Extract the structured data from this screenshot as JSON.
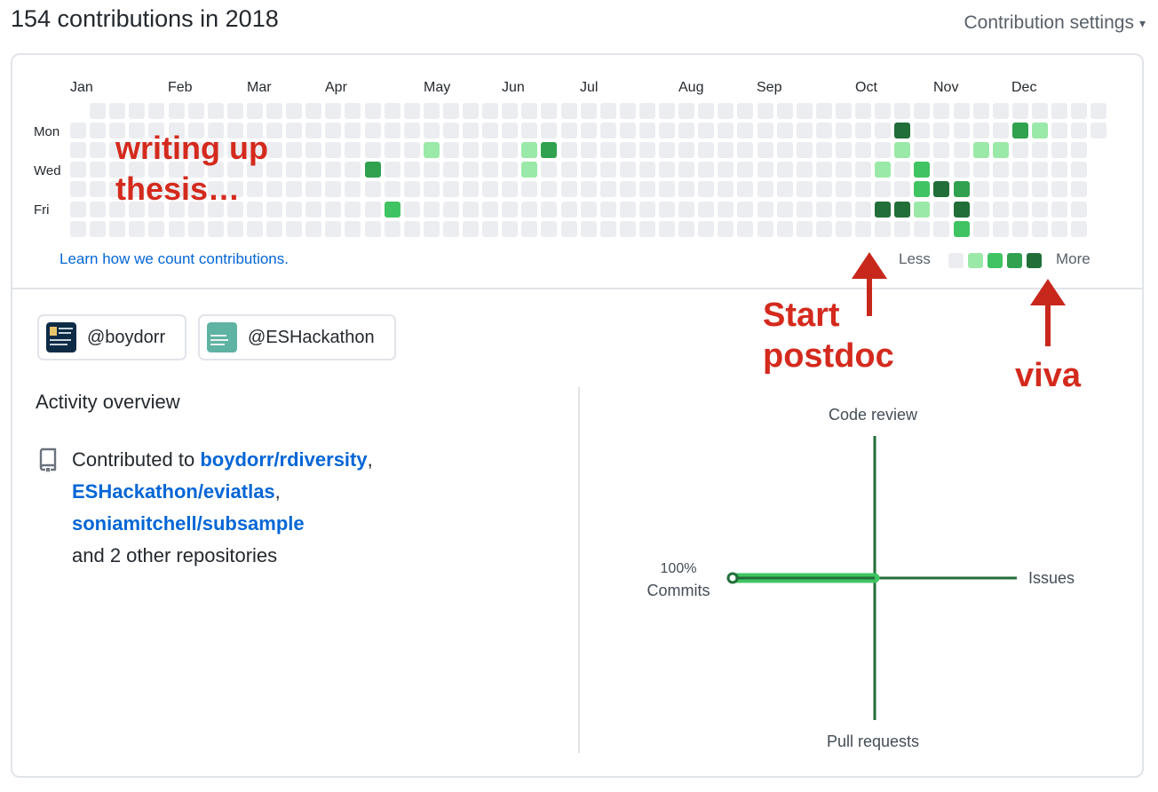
{
  "header": {
    "title": "154 contributions in 2018",
    "settings_label": "Contribution settings"
  },
  "calendar": {
    "months": [
      "Jan",
      "Feb",
      "Mar",
      "Apr",
      "May",
      "Jun",
      "Jul",
      "Aug",
      "Sep",
      "Oct",
      "Nov",
      "Dec"
    ],
    "days": [
      "Mon",
      "Wed",
      "Fri"
    ],
    "levels": [
      "#ebedf0",
      "#9be9a8",
      "#40c463",
      "#30a14e",
      "#216e39"
    ],
    "active_cells": [
      {
        "week": 15,
        "day": 3,
        "level": 3
      },
      {
        "week": 16,
        "day": 5,
        "level": 2
      },
      {
        "week": 18,
        "day": 2,
        "level": 1
      },
      {
        "week": 23,
        "day": 2,
        "level": 1
      },
      {
        "week": 23,
        "day": 3,
        "level": 1
      },
      {
        "week": 24,
        "day": 2,
        "level": 3
      },
      {
        "week": 41,
        "day": 3,
        "level": 1
      },
      {
        "week": 41,
        "day": 5,
        "level": 4
      },
      {
        "week": 42,
        "day": 1,
        "level": 4
      },
      {
        "week": 42,
        "day": 2,
        "level": 1
      },
      {
        "week": 42,
        "day": 5,
        "level": 4
      },
      {
        "week": 43,
        "day": 3,
        "level": 2
      },
      {
        "week": 43,
        "day": 4,
        "level": 2
      },
      {
        "week": 43,
        "day": 5,
        "level": 1
      },
      {
        "week": 44,
        "day": 4,
        "level": 4
      },
      {
        "week": 45,
        "day": 4,
        "level": 3
      },
      {
        "week": 45,
        "day": 5,
        "level": 4
      },
      {
        "week": 45,
        "day": 6,
        "level": 2
      },
      {
        "week": 46,
        "day": 2,
        "level": 1
      },
      {
        "week": 47,
        "day": 2,
        "level": 1
      },
      {
        "week": 48,
        "day": 1,
        "level": 3
      },
      {
        "week": 49,
        "day": 1,
        "level": 1
      }
    ],
    "learn_link": "Learn how we count contributions.",
    "legend_less": "Less",
    "legend_more": "More"
  },
  "annotations": {
    "thesis": "writing up thesis…",
    "postdoc": "Start postdoc",
    "viva": "viva"
  },
  "orgs": [
    {
      "handle": "@boydorr",
      "icon": "university-of-glasgow-logo"
    },
    {
      "handle": "@ESHackathon",
      "icon": "evidence-synthesis-hackathon-logo"
    }
  ],
  "activity": {
    "title": "Activity overview",
    "contributed_prefix": "Contributed to",
    "repos": [
      "boydorr/rdiversity",
      "ESHackathon/eviatlas",
      "soniamitchell/subsample"
    ],
    "others": "and 2 other repositories"
  },
  "chart_data": {
    "type": "radar",
    "axes": [
      "Code review",
      "Issues",
      "Pull requests",
      "Commits"
    ],
    "values": {
      "Commits": 100,
      "Issues": 0,
      "Code review": 0,
      "Pull requests": 0
    },
    "commits_label": "100%",
    "color": "#216e39",
    "highlight_color": "#40c463"
  }
}
